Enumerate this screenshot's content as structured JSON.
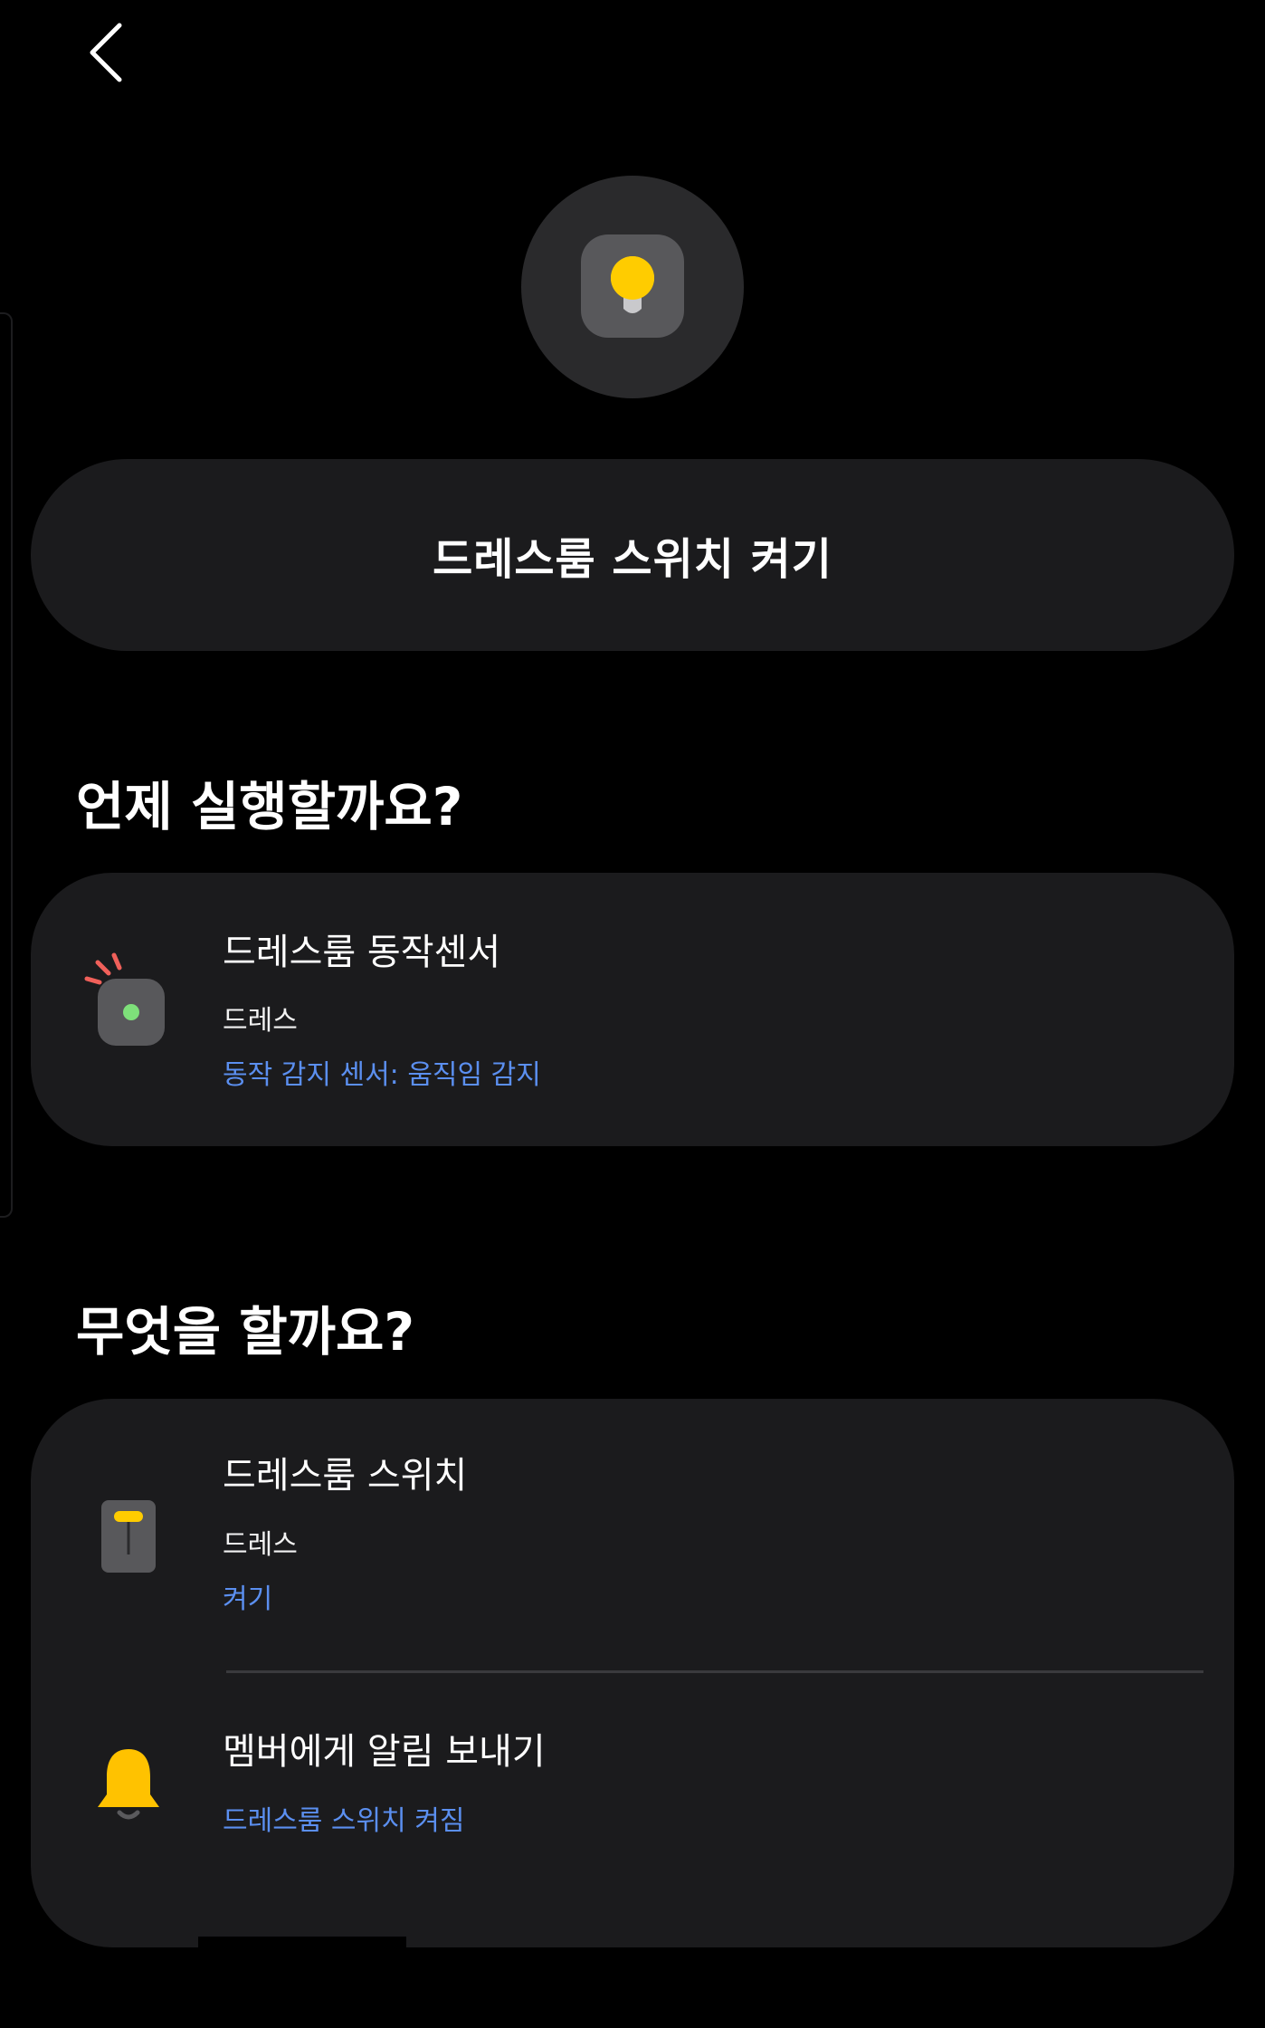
{
  "header": {
    "back_icon": "chevron-left-icon"
  },
  "scene": {
    "icon": "lightbulb-icon",
    "name": "드레스룸 스위치 켜기",
    "accent_color": "#ffcc00"
  },
  "when_section": {
    "heading": "언제 실행할까요?",
    "condition": {
      "icon": "motion-sensor-icon",
      "title": "드레스룸 동작센서",
      "location": "드레스",
      "status": "동작 감지 센서: 움직임 감지"
    }
  },
  "what_section": {
    "heading": "무엇을 할까요?",
    "actions": [
      {
        "icon": "switch-icon",
        "title": "드레스룸 스위치",
        "location": "드레스",
        "status": "켜기"
      },
      {
        "icon": "bell-icon",
        "title": "멤버에게 알림 보내기",
        "status": "드레스룸 스위치 켜짐"
      }
    ]
  },
  "colors": {
    "status_text": "#5b8ff0",
    "card_bg": "#1b1b1d",
    "sensor_dot": "#7ee07a",
    "sensor_signal": "#f0605a",
    "bell": "#ffc200"
  }
}
